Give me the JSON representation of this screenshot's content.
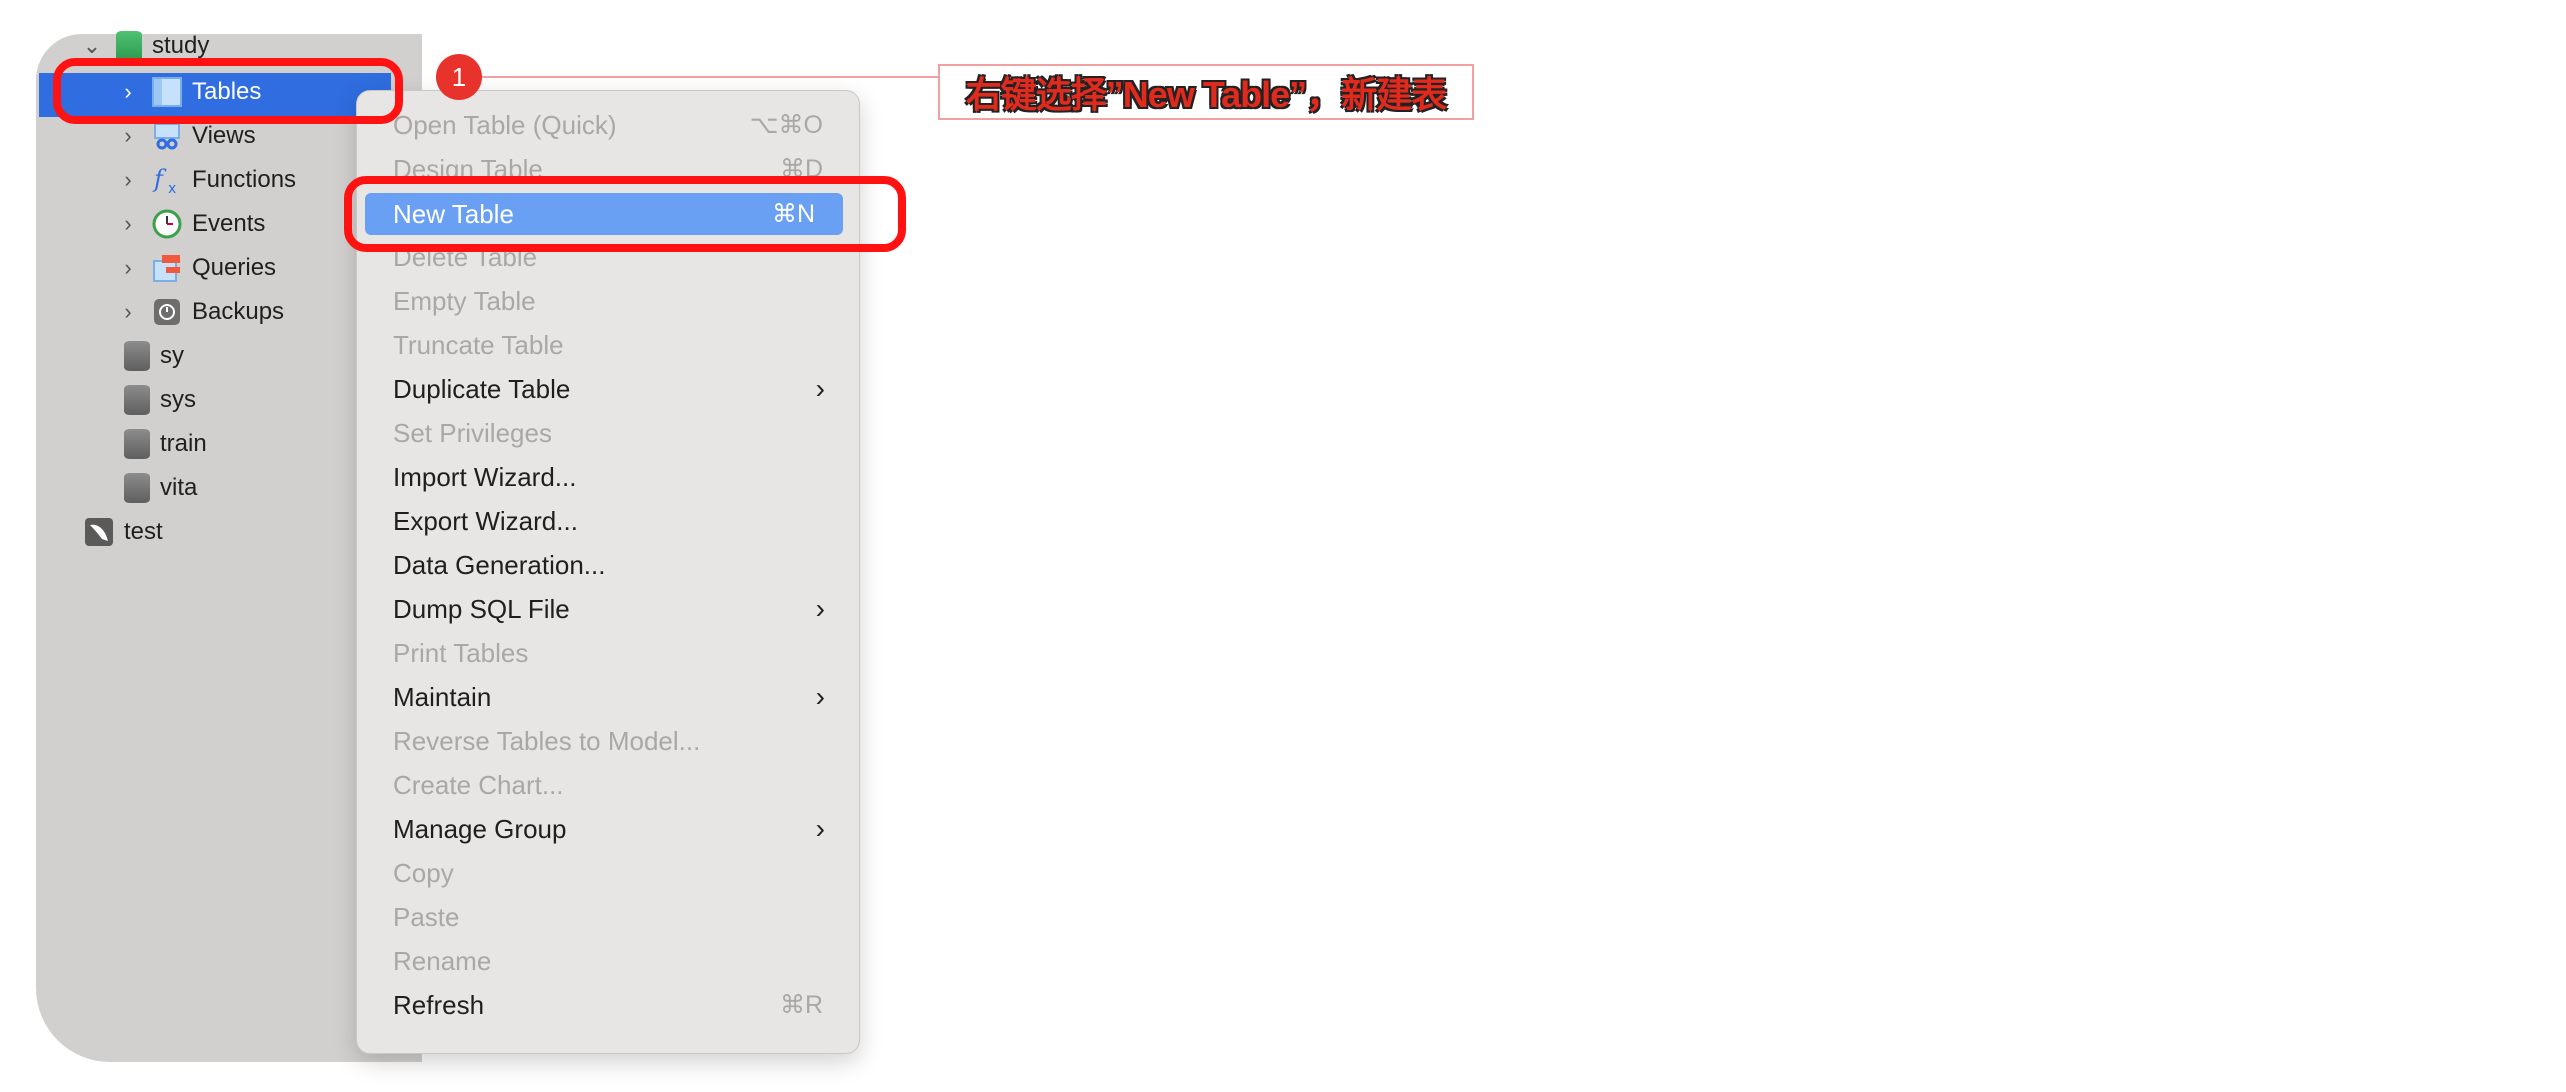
{
  "sidebar": {
    "items": [
      {
        "label": "study",
        "chevron": "⌄",
        "icon": "database-green-icon"
      },
      {
        "label": "Tables",
        "chevron": "›",
        "icon": "table-icon"
      },
      {
        "label": "Views",
        "chevron": "›",
        "icon": "views-icon"
      },
      {
        "label": "Functions",
        "chevron": "›",
        "icon": "function-icon"
      },
      {
        "label": "Events",
        "chevron": "›",
        "icon": "clock-icon"
      },
      {
        "label": "Queries",
        "chevron": "›",
        "icon": "queries-icon"
      },
      {
        "label": "Backups",
        "chevron": "›",
        "icon": "backup-icon"
      },
      {
        "label": "sy",
        "icon": "database-icon"
      },
      {
        "label": "sys",
        "icon": "database-icon"
      },
      {
        "label": "train",
        "icon": "database-icon"
      },
      {
        "label": "vita",
        "icon": "database-icon"
      },
      {
        "label": "test",
        "icon": "connection-icon"
      }
    ]
  },
  "annotation": {
    "badge": "1",
    "callout": "右键选择”New Table”，新建表"
  },
  "menu": {
    "items": [
      {
        "label": "Open Table (Quick)",
        "shortcut": "⌥⌘O",
        "state": "disabled"
      },
      {
        "label": "Design Table",
        "shortcut": "⌘D",
        "state": "disabled"
      },
      {
        "label": "New Table",
        "shortcut": "⌘N",
        "state": "active"
      },
      {
        "label": "Delete Table",
        "state": "disabled"
      },
      {
        "label": "Empty Table",
        "state": "disabled"
      },
      {
        "label": "Truncate Table",
        "state": "disabled"
      },
      {
        "label": "Duplicate Table",
        "submenu": "›",
        "state": "enabled"
      },
      {
        "label": "Set Privileges",
        "state": "disabled"
      },
      {
        "label": "Import Wizard...",
        "state": "enabled"
      },
      {
        "label": "Export Wizard...",
        "state": "enabled"
      },
      {
        "label": "Data Generation...",
        "state": "enabled"
      },
      {
        "label": "Dump SQL File",
        "submenu": "›",
        "state": "enabled"
      },
      {
        "label": "Print Tables",
        "state": "disabled"
      },
      {
        "label": "Maintain",
        "submenu": "›",
        "state": "enabled"
      },
      {
        "label": "Reverse Tables to Model...",
        "state": "disabled"
      },
      {
        "label": "Create Chart...",
        "state": "disabled"
      },
      {
        "label": "Manage Group",
        "submenu": "›",
        "state": "enabled"
      },
      {
        "label": "Copy",
        "state": "disabled"
      },
      {
        "label": "Paste",
        "state": "disabled"
      },
      {
        "label": "Rename",
        "state": "disabled"
      },
      {
        "label": "Refresh",
        "shortcut": "⌘R",
        "state": "enabled"
      }
    ]
  },
  "colors": {
    "selection": "#2f6de0",
    "menu_highlight": "#6aa0f4",
    "annotation_red": "#ff1212"
  }
}
